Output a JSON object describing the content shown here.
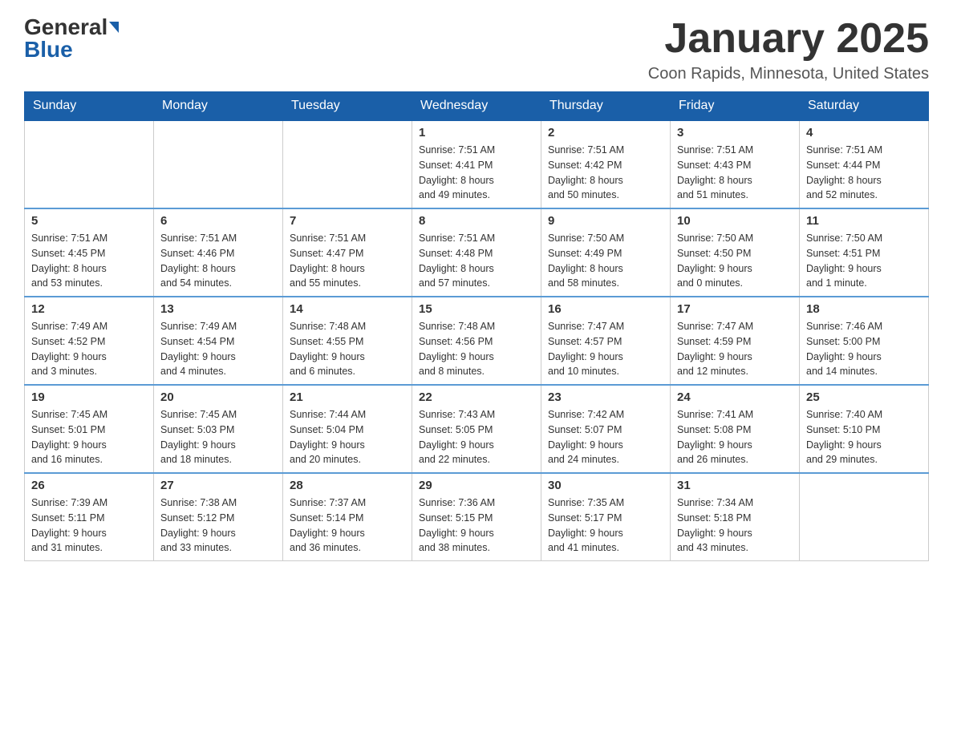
{
  "header": {
    "logo_general": "General",
    "logo_blue": "Blue",
    "month_title": "January 2025",
    "location": "Coon Rapids, Minnesota, United States"
  },
  "days_of_week": [
    "Sunday",
    "Monday",
    "Tuesday",
    "Wednesday",
    "Thursday",
    "Friday",
    "Saturday"
  ],
  "weeks": [
    [
      {
        "day": "",
        "info": ""
      },
      {
        "day": "",
        "info": ""
      },
      {
        "day": "",
        "info": ""
      },
      {
        "day": "1",
        "info": "Sunrise: 7:51 AM\nSunset: 4:41 PM\nDaylight: 8 hours\nand 49 minutes."
      },
      {
        "day": "2",
        "info": "Sunrise: 7:51 AM\nSunset: 4:42 PM\nDaylight: 8 hours\nand 50 minutes."
      },
      {
        "day": "3",
        "info": "Sunrise: 7:51 AM\nSunset: 4:43 PM\nDaylight: 8 hours\nand 51 minutes."
      },
      {
        "day": "4",
        "info": "Sunrise: 7:51 AM\nSunset: 4:44 PM\nDaylight: 8 hours\nand 52 minutes."
      }
    ],
    [
      {
        "day": "5",
        "info": "Sunrise: 7:51 AM\nSunset: 4:45 PM\nDaylight: 8 hours\nand 53 minutes."
      },
      {
        "day": "6",
        "info": "Sunrise: 7:51 AM\nSunset: 4:46 PM\nDaylight: 8 hours\nand 54 minutes."
      },
      {
        "day": "7",
        "info": "Sunrise: 7:51 AM\nSunset: 4:47 PM\nDaylight: 8 hours\nand 55 minutes."
      },
      {
        "day": "8",
        "info": "Sunrise: 7:51 AM\nSunset: 4:48 PM\nDaylight: 8 hours\nand 57 minutes."
      },
      {
        "day": "9",
        "info": "Sunrise: 7:50 AM\nSunset: 4:49 PM\nDaylight: 8 hours\nand 58 minutes."
      },
      {
        "day": "10",
        "info": "Sunrise: 7:50 AM\nSunset: 4:50 PM\nDaylight: 9 hours\nand 0 minutes."
      },
      {
        "day": "11",
        "info": "Sunrise: 7:50 AM\nSunset: 4:51 PM\nDaylight: 9 hours\nand 1 minute."
      }
    ],
    [
      {
        "day": "12",
        "info": "Sunrise: 7:49 AM\nSunset: 4:52 PM\nDaylight: 9 hours\nand 3 minutes."
      },
      {
        "day": "13",
        "info": "Sunrise: 7:49 AM\nSunset: 4:54 PM\nDaylight: 9 hours\nand 4 minutes."
      },
      {
        "day": "14",
        "info": "Sunrise: 7:48 AM\nSunset: 4:55 PM\nDaylight: 9 hours\nand 6 minutes."
      },
      {
        "day": "15",
        "info": "Sunrise: 7:48 AM\nSunset: 4:56 PM\nDaylight: 9 hours\nand 8 minutes."
      },
      {
        "day": "16",
        "info": "Sunrise: 7:47 AM\nSunset: 4:57 PM\nDaylight: 9 hours\nand 10 minutes."
      },
      {
        "day": "17",
        "info": "Sunrise: 7:47 AM\nSunset: 4:59 PM\nDaylight: 9 hours\nand 12 minutes."
      },
      {
        "day": "18",
        "info": "Sunrise: 7:46 AM\nSunset: 5:00 PM\nDaylight: 9 hours\nand 14 minutes."
      }
    ],
    [
      {
        "day": "19",
        "info": "Sunrise: 7:45 AM\nSunset: 5:01 PM\nDaylight: 9 hours\nand 16 minutes."
      },
      {
        "day": "20",
        "info": "Sunrise: 7:45 AM\nSunset: 5:03 PM\nDaylight: 9 hours\nand 18 minutes."
      },
      {
        "day": "21",
        "info": "Sunrise: 7:44 AM\nSunset: 5:04 PM\nDaylight: 9 hours\nand 20 minutes."
      },
      {
        "day": "22",
        "info": "Sunrise: 7:43 AM\nSunset: 5:05 PM\nDaylight: 9 hours\nand 22 minutes."
      },
      {
        "day": "23",
        "info": "Sunrise: 7:42 AM\nSunset: 5:07 PM\nDaylight: 9 hours\nand 24 minutes."
      },
      {
        "day": "24",
        "info": "Sunrise: 7:41 AM\nSunset: 5:08 PM\nDaylight: 9 hours\nand 26 minutes."
      },
      {
        "day": "25",
        "info": "Sunrise: 7:40 AM\nSunset: 5:10 PM\nDaylight: 9 hours\nand 29 minutes."
      }
    ],
    [
      {
        "day": "26",
        "info": "Sunrise: 7:39 AM\nSunset: 5:11 PM\nDaylight: 9 hours\nand 31 minutes."
      },
      {
        "day": "27",
        "info": "Sunrise: 7:38 AM\nSunset: 5:12 PM\nDaylight: 9 hours\nand 33 minutes."
      },
      {
        "day": "28",
        "info": "Sunrise: 7:37 AM\nSunset: 5:14 PM\nDaylight: 9 hours\nand 36 minutes."
      },
      {
        "day": "29",
        "info": "Sunrise: 7:36 AM\nSunset: 5:15 PM\nDaylight: 9 hours\nand 38 minutes."
      },
      {
        "day": "30",
        "info": "Sunrise: 7:35 AM\nSunset: 5:17 PM\nDaylight: 9 hours\nand 41 minutes."
      },
      {
        "day": "31",
        "info": "Sunrise: 7:34 AM\nSunset: 5:18 PM\nDaylight: 9 hours\nand 43 minutes."
      },
      {
        "day": "",
        "info": ""
      }
    ]
  ]
}
